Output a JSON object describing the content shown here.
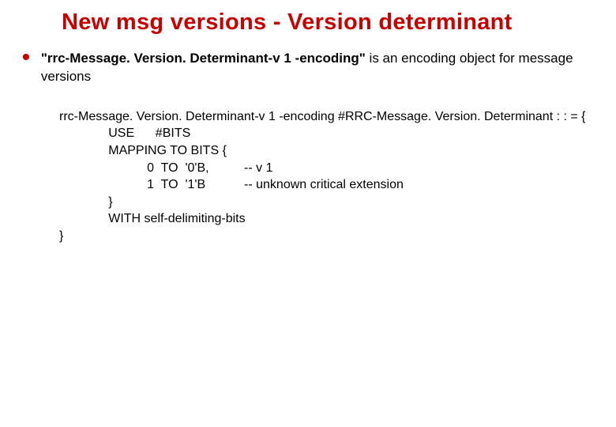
{
  "title": "New msg versions - Version determinant",
  "bullet": {
    "quoted": "\"rrc-Message. Version. Determinant-v 1 -encoding\"",
    "rest": "  is an encoding object for message versions"
  },
  "code": {
    "l1": "rrc-Message. Version. Determinant-v 1 -encoding #RRC-Message. Version. Determinant : : = {",
    "l2": "              USE      #BITS",
    "l3": "              MAPPING TO BITS {",
    "l4": "                         0  TO  '0'B,          -- v 1",
    "l5": "                         1  TO  '1'B           -- unknown critical extension",
    "l6": "              }",
    "l7": "              WITH self-delimiting-bits",
    "l8": "}"
  }
}
